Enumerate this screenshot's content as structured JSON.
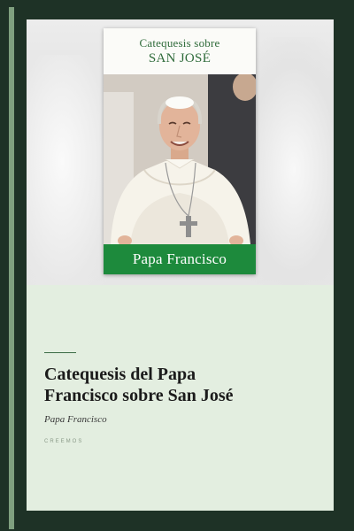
{
  "inner_cover": {
    "subtitle": "Catequesis sobre",
    "title": "SAN JOSÉ",
    "author": "Papa Francisco"
  },
  "book": {
    "title_line1": "Catequesis del Papa",
    "title_line2": "Francisco sobre San José",
    "author": "Papa Francisco",
    "publisher": "CREEMOS"
  },
  "colors": {
    "background": "#1e3226",
    "accent_stripe": "#7fa07f",
    "card": "#e3eee0",
    "cover_green": "#1d8a3c",
    "cover_text_green": "#2f6b3a"
  },
  "icons": {
    "cover_photo": "pope-portrait-image"
  }
}
